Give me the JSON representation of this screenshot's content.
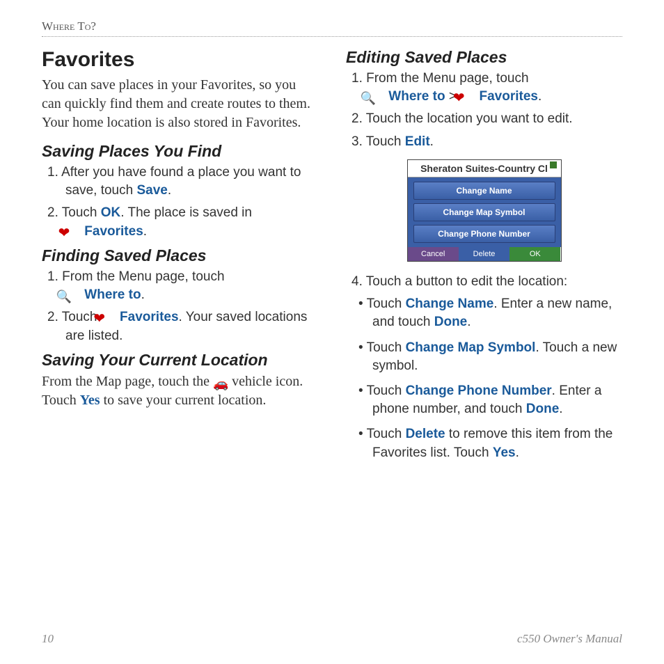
{
  "header": {
    "section": "Where To?"
  },
  "left": {
    "h1": "Favorites",
    "intro": "You can save places in your Favorites, so you can quickly find them and create routes to them. Your home location is also stored in Favorites.",
    "s1": {
      "title": "Saving Places You Find",
      "li1a": "1.  After you have found a place you want to save, touch ",
      "li1_kw": "Save",
      "li2a": "2.  Touch ",
      "li2_ok": "OK",
      "li2b": ". The place is saved in ",
      "li2_fav": "Favorites",
      "li2c": "."
    },
    "s2": {
      "title": "Finding Saved Places",
      "li1a": "1.  From the Menu page, touch ",
      "li1_kw": "Where to",
      "li2a": "2.  Touch ",
      "li2_fav": "Favorites",
      "li2b": ". Your saved locations are listed."
    },
    "s3": {
      "title": "Saving Your Current Location",
      "p_a": "From the Map page, touch the ",
      "p_b": " vehicle icon. Touch ",
      "p_yes": "Yes",
      "p_c": " to save your current location."
    }
  },
  "right": {
    "title": "Editing Saved Places",
    "li1a": "1.  From the Menu page, touch ",
    "li1_where": "Where to",
    "li1_gt": " > ",
    "li1_fav": "Favorites",
    "li2": "2.  Touch the location you want to edit.",
    "li3a": "3.  Touch ",
    "li3_edit": "Edit",
    "device": {
      "title": "Sheraton Suites-Country Cl",
      "b1": "Change Name",
      "b2": "Change Map Symbol",
      "b3": "Change Phone Number",
      "cancel": "Cancel",
      "delete": "Delete",
      "ok": "OK"
    },
    "li4": "4.  Touch a button to edit the location:",
    "u1a": "Touch ",
    "u1_kw": "Change Name",
    "u1b": ". Enter a new name, and touch ",
    "u1_done": "Done",
    "u1c": ".",
    "u2a": "Touch ",
    "u2_kw": "Change Map Symbol",
    "u2b": ". Touch a new symbol.",
    "u3a": "Touch ",
    "u3_kw": "Change Phone Number",
    "u3b": ". Enter a phone number, and touch ",
    "u3_done": "Done",
    "u3c": ".",
    "u4a": "Touch ",
    "u4_kw": "Delete",
    "u4b": " to remove this item from the Favorites list. Touch ",
    "u4_yes": "Yes",
    "u4c": "."
  },
  "footer": {
    "page": "10",
    "doc": "c550 Owner's Manual"
  }
}
